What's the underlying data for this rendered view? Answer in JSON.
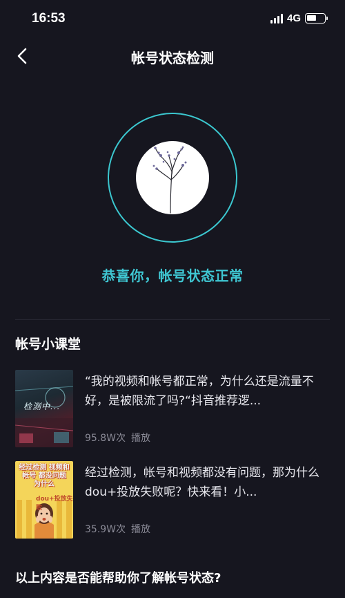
{
  "status_bar": {
    "time": "16:53",
    "network": "4G",
    "battery_level": 0.55
  },
  "nav": {
    "title": "帐号状态检测",
    "back_icon": "chevron-left-icon"
  },
  "result": {
    "message": "恭喜你，帐号状态正常",
    "accent_color": "#3fc6d2"
  },
  "course": {
    "title": "帐号小课堂",
    "items": [
      {
        "title": "“我的视频和帐号都正常，为什么还是流量不好，是被限流了吗?“抖音推荐逻...",
        "plays": "95.8W次",
        "plays_label": "播放",
        "thumb_text": "检测中..."
      },
      {
        "title": "经过检测，帐号和视频都没有问题，那为什么dou+投放失败呢？快来看！小...",
        "plays": "35.9W次",
        "plays_label": "播放",
        "thumb_text": "经过检测 视频和帐号 都没问题 为什么",
        "thumb_tag": "dou+投放失败"
      }
    ]
  },
  "feedback": {
    "question": "以上内容是否能帮助你了解帐号状态?"
  }
}
